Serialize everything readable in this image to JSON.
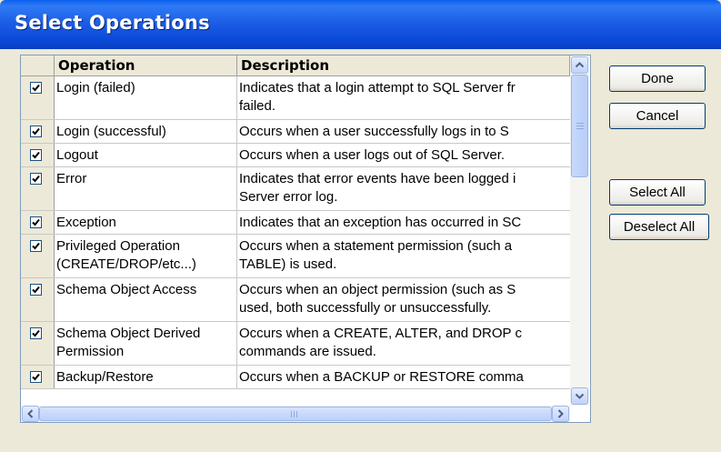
{
  "window": {
    "title": "Select Operations"
  },
  "grid": {
    "headers": {
      "check": "",
      "operation": "Operation",
      "description": "Description"
    },
    "rows": [
      {
        "checked": true,
        "operation": "Login (failed)",
        "description": "Indicates that a login attempt to SQL Server fr\nfailed."
      },
      {
        "checked": true,
        "operation": "Login (successful)",
        "description": "Occurs when a user successfully logs in to S"
      },
      {
        "checked": true,
        "operation": "Logout",
        "description": "Occurs when a user logs out of SQL Server."
      },
      {
        "checked": true,
        "operation": "Error",
        "description": "Indicates that error events have been logged i\nServer error log."
      },
      {
        "checked": true,
        "operation": "Exception",
        "description": "Indicates that an exception has occurred in SC"
      },
      {
        "checked": true,
        "operation": "Privileged Operation\n(CREATE/DROP/etc...)",
        "description": "Occurs when a statement permission (such a\nTABLE) is used."
      },
      {
        "checked": true,
        "operation": "Schema Object Access",
        "description": "Occurs when an object permission (such as S\nused, both successfully or unsuccessfully."
      },
      {
        "checked": true,
        "operation": "Schema Object Derived\nPermission",
        "description": "Occurs when a CREATE, ALTER, and DROP c\ncommands are issued."
      },
      {
        "checked": true,
        "operation": "Backup/Restore",
        "description": "Occurs when a BACKUP or RESTORE comma"
      }
    ]
  },
  "buttons": {
    "done": "Done",
    "cancel": "Cancel",
    "select_all": "Select All",
    "deselect_all": "Deselect All"
  }
}
